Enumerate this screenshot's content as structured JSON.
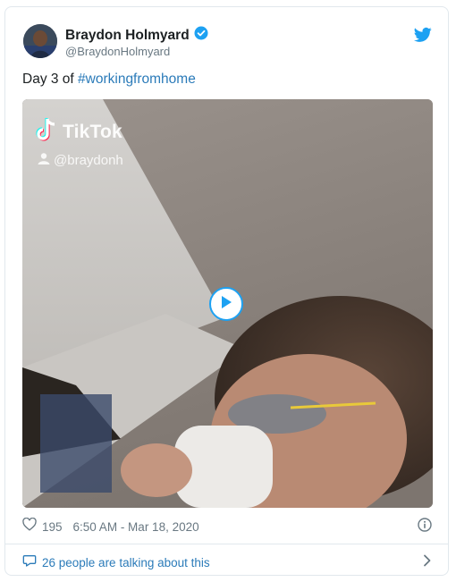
{
  "user": {
    "display_name": "Braydon Holmyard",
    "handle": "@BraydonHolmyard",
    "verified": true
  },
  "tweet": {
    "text_prefix": "Day 3 of ",
    "hashtag": "#workingfromhome"
  },
  "media": {
    "watermark": "TikTok",
    "creator_handle": "@braydonh"
  },
  "stats": {
    "likes": "195",
    "timestamp": "6:50 AM - Mar 18, 2020"
  },
  "conversation": {
    "label": "26 people are talking about this"
  },
  "colors": {
    "accent": "#1da1f2",
    "link": "#2b7bb9",
    "muted": "#697882"
  },
  "icons": [
    "avatar",
    "verified-badge-icon",
    "twitter-bird-icon",
    "tiktok-logo-icon",
    "user-icon",
    "play-icon",
    "heart-icon",
    "info-icon",
    "comment-icon",
    "chevron-right-icon"
  ]
}
